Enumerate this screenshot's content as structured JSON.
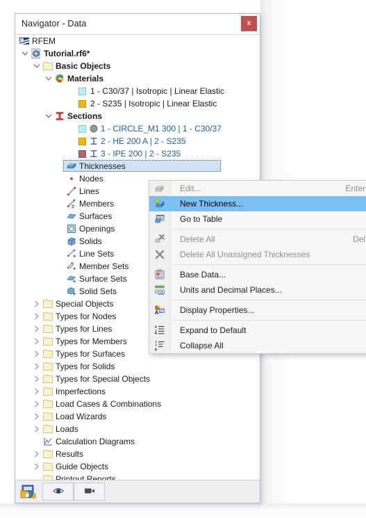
{
  "window": {
    "title": "Navigator - Data",
    "close_label": "x"
  },
  "tree": {
    "items": [
      {
        "label": "RFEM",
        "indent": 0,
        "chev": "none",
        "icon": "rfem-logo-icon",
        "bold": false,
        "color": "dark"
      },
      {
        "label": "Tutorial.rf6*",
        "indent": 1,
        "chev": "expanded",
        "icon": "model-file-icon",
        "bold": true,
        "color": "dark"
      },
      {
        "label": "Basic Objects",
        "indent": 2,
        "chev": "expanded",
        "icon": "folder-icon",
        "bold": true,
        "color": "dark"
      },
      {
        "label": "Materials",
        "indent": 3,
        "chev": "expanded",
        "icon": "materials-icon",
        "bold": true,
        "color": "dark"
      },
      {
        "label": "1 - C30/37 | Isotropic | Linear Elastic",
        "indent": 5,
        "chev": "none",
        "icon": "swatch-cyan",
        "bold": false,
        "color": "dark"
      },
      {
        "label": "2 - S235 | Isotropic | Linear Elastic",
        "indent": 5,
        "chev": "none",
        "icon": "swatch-amber",
        "bold": false,
        "color": "dark"
      },
      {
        "label": "Sections",
        "indent": 3,
        "chev": "expanded",
        "icon": "sections-icon",
        "bold": true,
        "color": "dark"
      },
      {
        "label": "1 - CIRCLE_M1 300 | 1 - C30/37",
        "indent": 5,
        "chev": "none",
        "icon": "section-circle",
        "bold": false,
        "color": "blue"
      },
      {
        "label": "2 - HE 200 A | 2 - S235",
        "indent": 5,
        "chev": "none",
        "icon": "section-i-amber",
        "bold": false,
        "color": "blue"
      },
      {
        "label": "3 - IPE 200 | 2 - S235",
        "indent": 5,
        "chev": "none",
        "icon": "section-i-rose",
        "bold": false,
        "color": "blue"
      },
      {
        "label": "Thicknesses",
        "indent": 4,
        "chev": "none",
        "icon": "thickness-icon",
        "bold": false,
        "color": "dark",
        "selected": true
      },
      {
        "label": "Nodes",
        "indent": 4,
        "chev": "none",
        "icon": "node-icon",
        "bold": false,
        "color": "dark"
      },
      {
        "label": "Lines",
        "indent": 4,
        "chev": "none",
        "icon": "line-icon",
        "bold": false,
        "color": "dark"
      },
      {
        "label": "Members",
        "indent": 4,
        "chev": "none",
        "icon": "member-icon",
        "bold": false,
        "color": "dark"
      },
      {
        "label": "Surfaces",
        "indent": 4,
        "chev": "none",
        "icon": "surface-icon",
        "bold": false,
        "color": "dark"
      },
      {
        "label": "Openings",
        "indent": 4,
        "chev": "none",
        "icon": "opening-icon",
        "bold": false,
        "color": "dark"
      },
      {
        "label": "Solids",
        "indent": 4,
        "chev": "none",
        "icon": "solid-icon",
        "bold": false,
        "color": "dark"
      },
      {
        "label": "Line Sets",
        "indent": 4,
        "chev": "none",
        "icon": "line-set-icon",
        "bold": false,
        "color": "dark"
      },
      {
        "label": "Member Sets",
        "indent": 4,
        "chev": "none",
        "icon": "member-set-icon",
        "bold": false,
        "color": "dark"
      },
      {
        "label": "Surface Sets",
        "indent": 4,
        "chev": "none",
        "icon": "surface-set-icon",
        "bold": false,
        "color": "dark"
      },
      {
        "label": "Solid Sets",
        "indent": 4,
        "chev": "none",
        "icon": "solid-set-icon",
        "bold": false,
        "color": "dark"
      },
      {
        "label": "Special Objects",
        "indent": 2,
        "chev": "collapsed",
        "icon": "folder-icon",
        "bold": false,
        "color": "dark"
      },
      {
        "label": "Types for Nodes",
        "indent": 2,
        "chev": "collapsed",
        "icon": "folder-icon",
        "bold": false,
        "color": "dark"
      },
      {
        "label": "Types for Lines",
        "indent": 2,
        "chev": "collapsed",
        "icon": "folder-icon",
        "bold": false,
        "color": "dark"
      },
      {
        "label": "Types for Members",
        "indent": 2,
        "chev": "collapsed",
        "icon": "folder-icon",
        "bold": false,
        "color": "dark"
      },
      {
        "label": "Types for Surfaces",
        "indent": 2,
        "chev": "collapsed",
        "icon": "folder-icon",
        "bold": false,
        "color": "dark"
      },
      {
        "label": "Types for Solids",
        "indent": 2,
        "chev": "collapsed",
        "icon": "folder-icon",
        "bold": false,
        "color": "dark"
      },
      {
        "label": "Types for Special Objects",
        "indent": 2,
        "chev": "collapsed",
        "icon": "folder-icon",
        "bold": false,
        "color": "dark"
      },
      {
        "label": "Imperfections",
        "indent": 2,
        "chev": "collapsed",
        "icon": "folder-icon",
        "bold": false,
        "color": "dark"
      },
      {
        "label": "Load Cases & Combinations",
        "indent": 2,
        "chev": "collapsed",
        "icon": "folder-icon",
        "bold": false,
        "color": "dark"
      },
      {
        "label": "Load Wizards",
        "indent": 2,
        "chev": "collapsed",
        "icon": "folder-icon",
        "bold": false,
        "color": "dark"
      },
      {
        "label": "Loads",
        "indent": 2,
        "chev": "collapsed",
        "icon": "folder-icon",
        "bold": false,
        "color": "dark"
      },
      {
        "label": "Calculation Diagrams",
        "indent": 2,
        "chev": "none",
        "icon": "diagram-icon",
        "bold": false,
        "color": "dark"
      },
      {
        "label": "Results",
        "indent": 2,
        "chev": "collapsed",
        "icon": "folder-icon",
        "bold": false,
        "color": "dark"
      },
      {
        "label": "Guide Objects",
        "indent": 2,
        "chev": "collapsed",
        "icon": "folder-icon",
        "bold": false,
        "color": "dark"
      },
      {
        "label": "Printout Reports",
        "indent": 2,
        "chev": "none",
        "icon": "folder-icon",
        "bold": false,
        "color": "dark"
      }
    ]
  },
  "context_menu": {
    "items": [
      {
        "kind": "item",
        "label": "Edit...",
        "shortcut": "Enter",
        "icon": "edit-thickness-icon",
        "disabled": true,
        "highlighted": false
      },
      {
        "kind": "item",
        "label": "New Thickness...",
        "shortcut": "",
        "icon": "new-thickness-icon",
        "disabled": false,
        "highlighted": true
      },
      {
        "kind": "item",
        "label": "Go to Table",
        "shortcut": "",
        "icon": "table-icon",
        "disabled": false,
        "highlighted": false
      },
      {
        "kind": "sep"
      },
      {
        "kind": "item",
        "label": "Delete All",
        "shortcut": "Del",
        "icon": "delete-all-icon",
        "disabled": true,
        "highlighted": false
      },
      {
        "kind": "item",
        "label": "Delete All Unassigned Thicknesses",
        "shortcut": "",
        "icon": "delete-unassigned-icon",
        "disabled": true,
        "highlighted": false
      },
      {
        "kind": "sep"
      },
      {
        "kind": "item",
        "label": "Base Data...",
        "shortcut": "",
        "icon": "base-data-icon",
        "disabled": false,
        "highlighted": false
      },
      {
        "kind": "item",
        "label": "Units and Decimal Places...",
        "shortcut": "",
        "icon": "units-decimals-icon",
        "disabled": false,
        "highlighted": false
      },
      {
        "kind": "sep"
      },
      {
        "kind": "item",
        "label": "Display Properties...",
        "shortcut": "",
        "icon": "display-properties-icon",
        "disabled": false,
        "highlighted": false
      },
      {
        "kind": "sep"
      },
      {
        "kind": "item",
        "label": "Expand to Default",
        "shortcut": "",
        "icon": "expand-default-icon",
        "disabled": false,
        "highlighted": false
      },
      {
        "kind": "item",
        "label": "Collapse All",
        "shortcut": "",
        "icon": "collapse-all-icon",
        "disabled": false,
        "highlighted": false
      }
    ]
  },
  "bottom_bar": {
    "tab_icon": "navigator-data-tab-icon",
    "buttons": [
      {
        "icon": "eye-visibility-icon"
      },
      {
        "icon": "video-camera-icon"
      }
    ]
  },
  "colors": {
    "accent_highlight": "#7cc0f3",
    "selection": "#cfe4f7",
    "close_button": "#c0504d",
    "link_text": "#1f5fa8",
    "material_c30": "#b5f0f2",
    "material_s235": "#f2b705",
    "section_ipe": "#b06a6a"
  }
}
